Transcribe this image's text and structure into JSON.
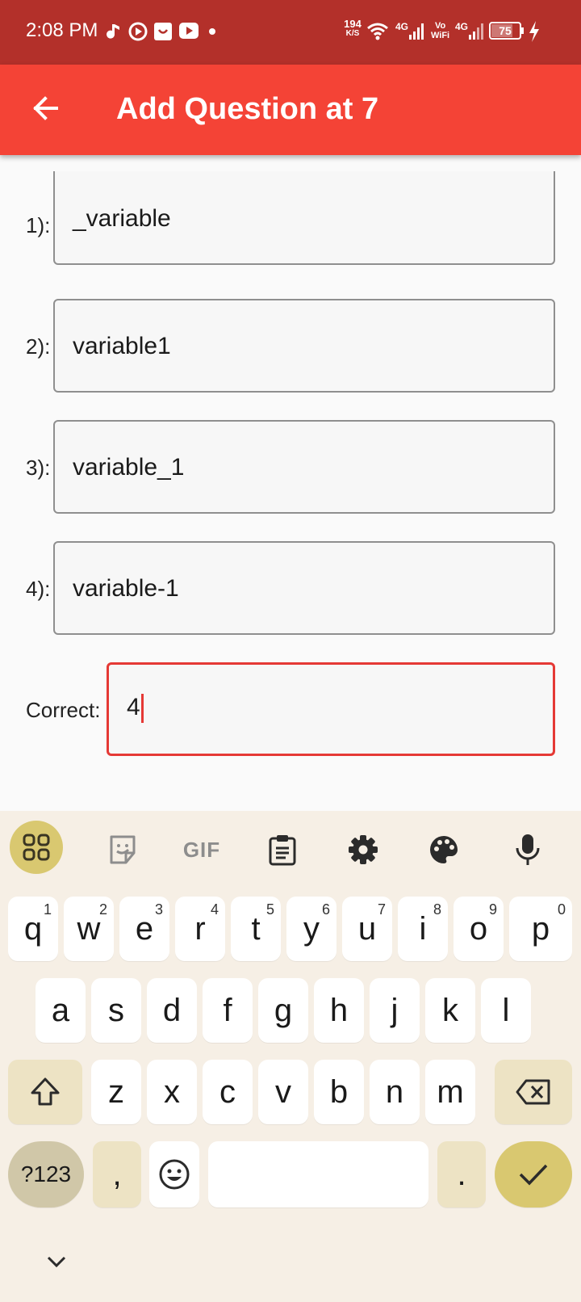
{
  "status_bar": {
    "time": "2:08 PM",
    "net_speed_value": "194",
    "net_speed_unit": "K/S",
    "sim1_label": "4G",
    "vowifi_label_top": "Vo",
    "vowifi_label_bottom": "WiFi",
    "sim2_label": "4G",
    "battery_level": "75"
  },
  "app_bar": {
    "title": "Add Question at 7"
  },
  "options": [
    {
      "label": "1):",
      "value": "_variable"
    },
    {
      "label": "2):",
      "value": "variable1"
    },
    {
      "label": "3):",
      "value": "variable_1"
    },
    {
      "label": "4):",
      "value": "variable-1"
    }
  ],
  "correct": {
    "label": "Correct:",
    "value": "4"
  },
  "keyboard": {
    "toolbar_icons": [
      "apps-grid-icon",
      "sticker-icon",
      "gif-icon",
      "clipboard-icon",
      "settings-gear-icon",
      "palette-icon",
      "microphone-icon"
    ],
    "gif_label": "GIF",
    "row1": [
      {
        "key": "q",
        "hint": "1"
      },
      {
        "key": "w",
        "hint": "2"
      },
      {
        "key": "e",
        "hint": "3"
      },
      {
        "key": "r",
        "hint": "4"
      },
      {
        "key": "t",
        "hint": "5"
      },
      {
        "key": "y",
        "hint": "6"
      },
      {
        "key": "u",
        "hint": "7"
      },
      {
        "key": "i",
        "hint": "8"
      },
      {
        "key": "o",
        "hint": "9"
      },
      {
        "key": "p",
        "hint": "0"
      }
    ],
    "row2": [
      "a",
      "s",
      "d",
      "f",
      "g",
      "h",
      "j",
      "k",
      "l"
    ],
    "row3": [
      "z",
      "x",
      "c",
      "v",
      "b",
      "n",
      "m"
    ],
    "symbols_key": "?123",
    "comma_key": ",",
    "period_key": ".",
    "accent_color": "#d9c870"
  },
  "colors": {
    "status_bar": "#b3302a",
    "app_bar": "#f44336",
    "focus_border": "#e53935"
  }
}
